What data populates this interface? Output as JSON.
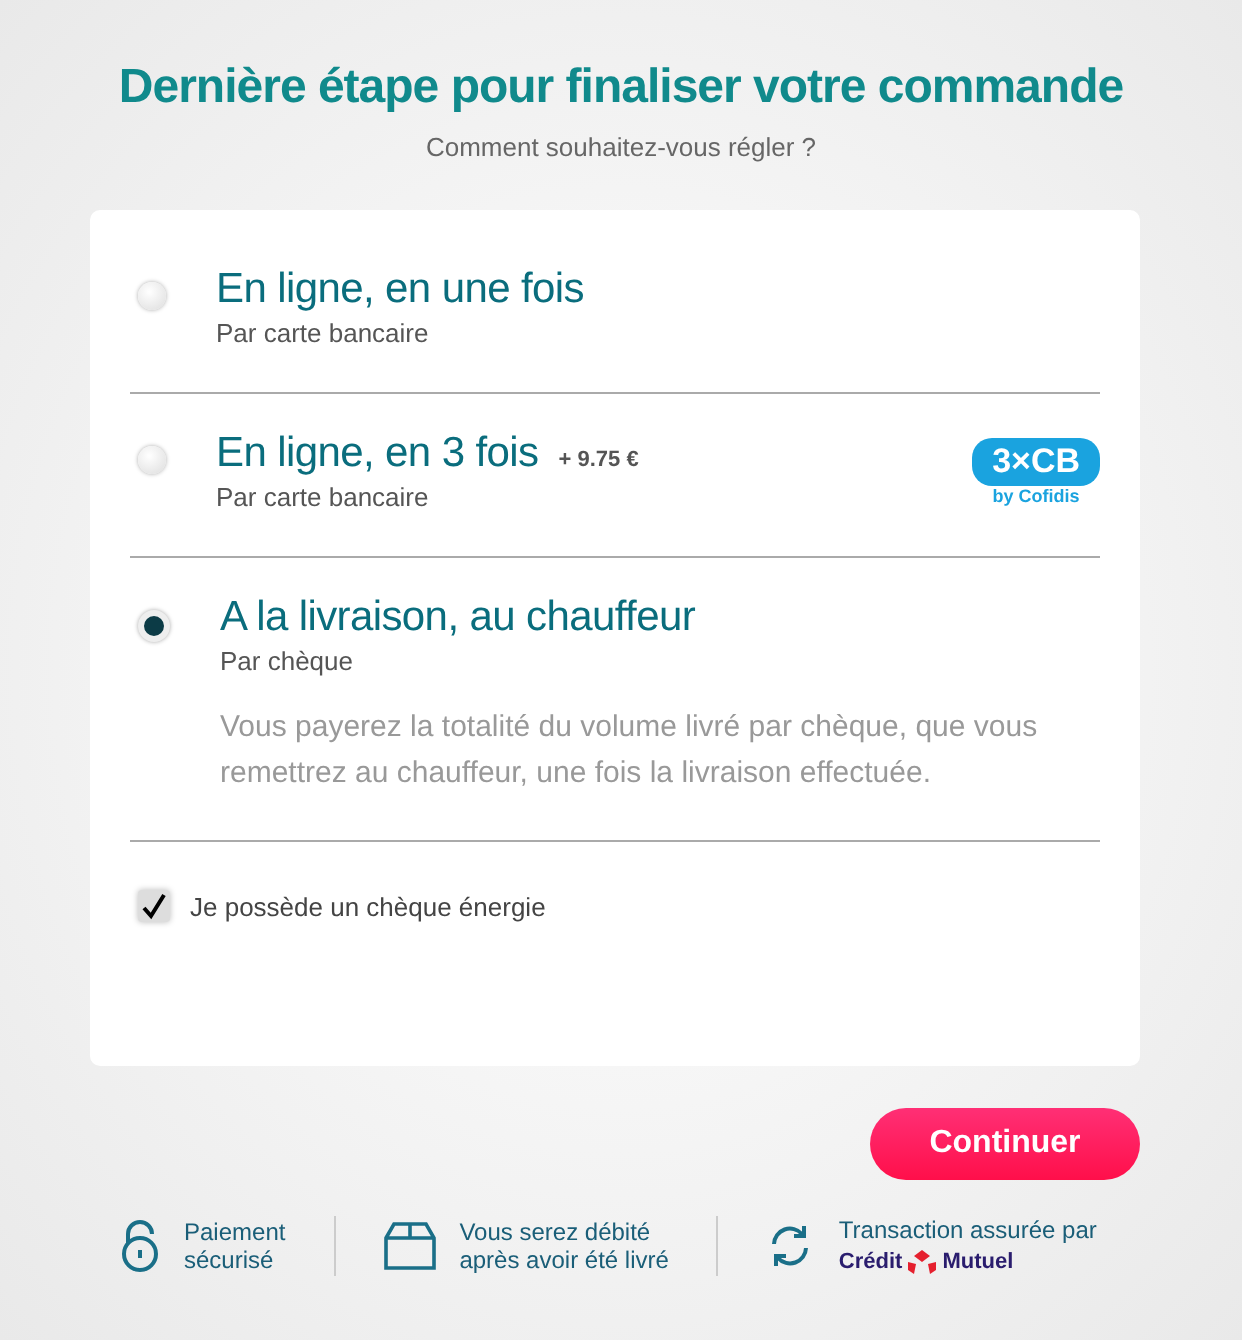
{
  "title": "Dernière étape pour finaliser votre commande",
  "subtitle": "Comment souhaitez-vous régler ?",
  "options": [
    {
      "title": "En ligne, en une fois",
      "subtitle": "Par carte bancaire",
      "selected": false
    },
    {
      "title": "En ligne, en 3 fois",
      "surcharge": "+ 9.75 €",
      "subtitle": "Par carte bancaire",
      "selected": false,
      "badge": {
        "label": "3×CB",
        "caption": "by Cofidis"
      }
    },
    {
      "title": "A la livraison, au chauffeur",
      "subtitle": "Par chèque",
      "selected": true,
      "description": "Vous payerez la totalité du volume livré par chèque, que vous remettrez au chauffeur, une fois la livraison effectuée."
    }
  ],
  "energy_check": {
    "label": "Je possède un chèque énergie",
    "checked": true
  },
  "continue_button": "Continuer",
  "footer": [
    {
      "kind": "lock",
      "lines": [
        "Paiement",
        "sécurisé"
      ]
    },
    {
      "kind": "box",
      "lines": [
        "Vous serez débité",
        "après avoir été livré"
      ]
    },
    {
      "kind": "refresh",
      "lines": [
        "Transaction assurée par"
      ],
      "brand": [
        "Crédit",
        "Mutuel"
      ]
    }
  ]
}
